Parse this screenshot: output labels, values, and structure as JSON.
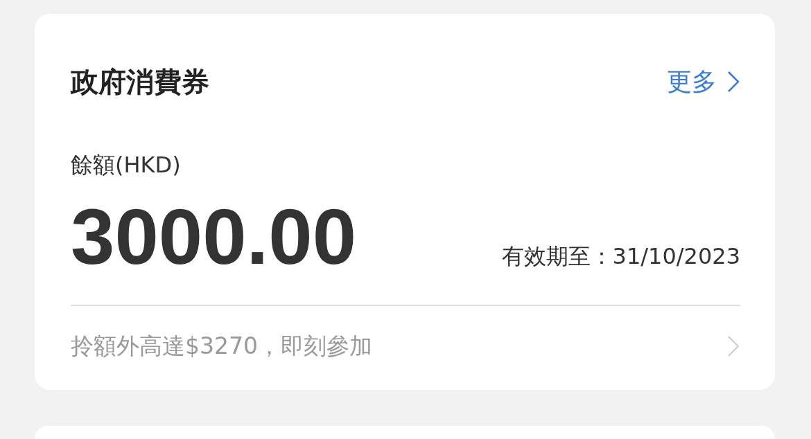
{
  "voucher_card": {
    "title": "政府消費券",
    "more_link": "更多",
    "balance_label": "餘額(HKD)",
    "balance": "3000.00",
    "expiry": "有效期至：31/10/2023",
    "promo": "拎額外高達$3270，即刻參加"
  }
}
